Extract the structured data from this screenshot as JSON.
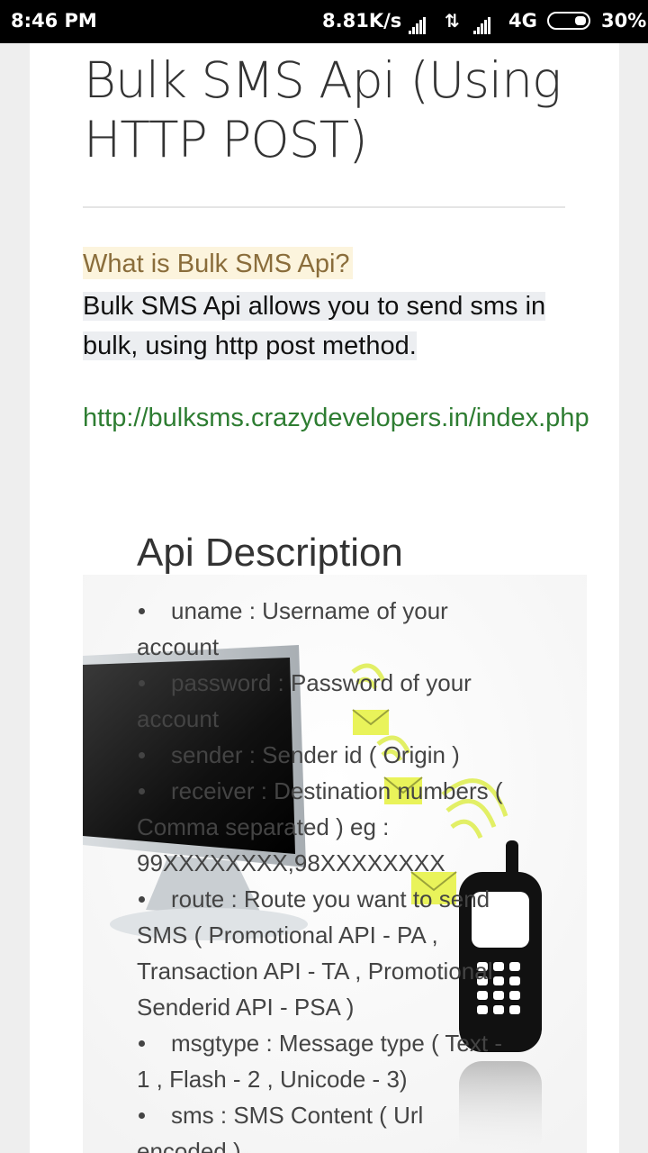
{
  "status_bar": {
    "time": "8:46 PM",
    "speed": "8.81K/s",
    "network": "4G",
    "battery": "30%",
    "battery_level": 0.3,
    "icons": [
      "signal-icon",
      "data-arrows-icon",
      "signal-icon",
      "battery-icon"
    ]
  },
  "article": {
    "title": "Bulk SMS Api (Using HTTP POST)",
    "question": "What is Bulk SMS Api?",
    "answer": "Bulk SMS Api allows you to send sms in bulk, using http post method.",
    "link": "http://bulksms.crazydevelopers.in/index.php",
    "colors": {
      "question_bg": "#fcf4dd",
      "question_text": "#8a6d3b",
      "link": "#2e7d32"
    }
  },
  "api_description": {
    "title": "Api Description",
    "items": [
      "uname : Username of your account",
      "password : Password of your account",
      "sender : Sender id ( Origin )",
      "receiver : Destination numbers ( Comma separated ) eg : 99XXXXXXXX,98XXXXXXXX",
      "route : Route you want to send SMS ( Promotional API - PA , Transaction API - TA , Promotional Senderid API - PSA )",
      "msgtype : Message type ( Text - 1 , Flash - 2 , Unicode - 3)",
      "sms : SMS Content ( Url encoded )"
    ]
  }
}
